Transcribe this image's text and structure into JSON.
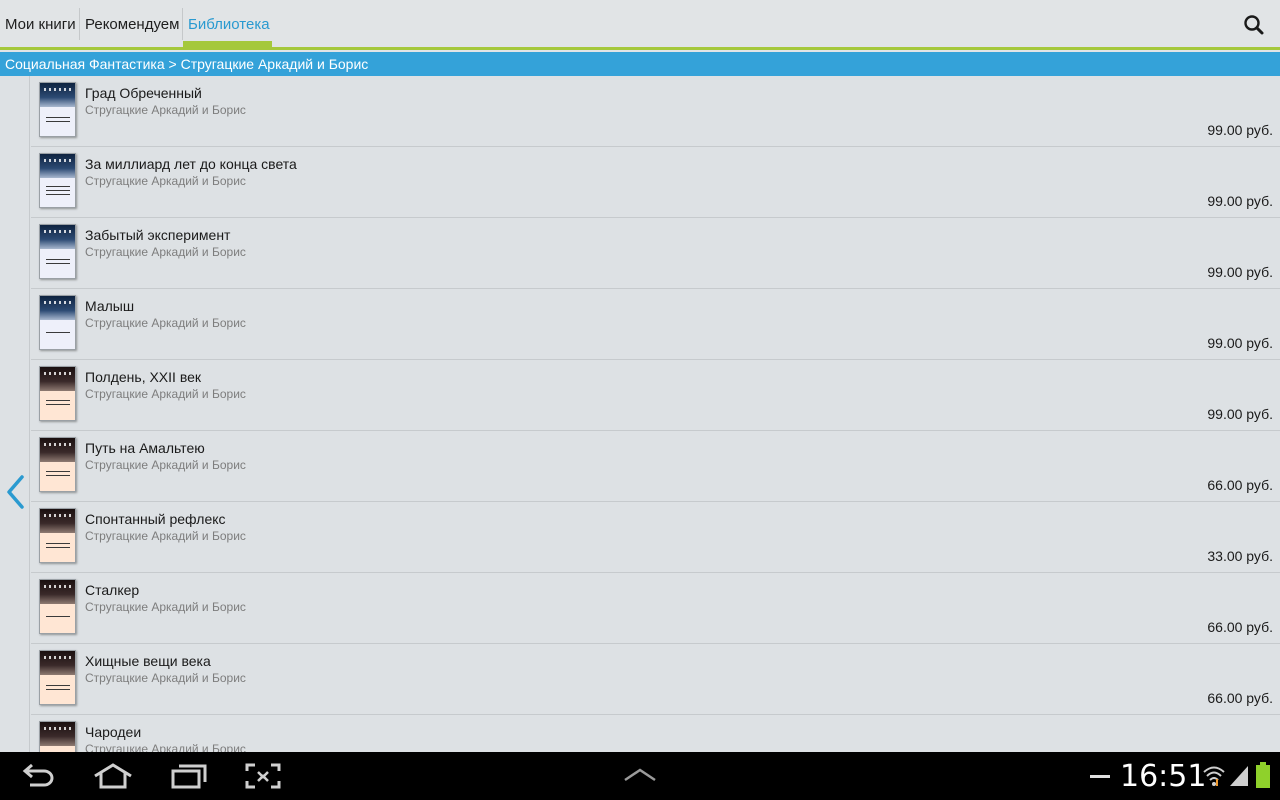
{
  "tabs": [
    {
      "label": "Мои книги"
    },
    {
      "label": "Рекомендуем"
    },
    {
      "label": "Библиотека"
    }
  ],
  "active_tab": "Библиотека",
  "breadcrumb": "Социальная Фантастика > Стругацкие Аркадий и Борис",
  "books": [
    {
      "title": "Град Обреченный",
      "author": "Стругацкие Аркадий и Борис",
      "price": "99.00 руб.",
      "cover": "blue"
    },
    {
      "title": "За миллиард лет до конца света",
      "author": "Стругацкие Аркадий и Борис",
      "price": "99.00 руб.",
      "cover": "blue"
    },
    {
      "title": "Забытый эксперимент",
      "author": "Стругацкие Аркадий и Борис",
      "price": "99.00 руб.",
      "cover": "blue"
    },
    {
      "title": "Малыш",
      "author": "Стругацкие Аркадий и Борис",
      "price": "99.00 руб.",
      "cover": "blue"
    },
    {
      "title": "Полдень, XXII век",
      "author": "Стругацкие Аркадий и Борис",
      "price": "99.00 руб.",
      "cover": "peach"
    },
    {
      "title": "Путь на Амальтею",
      "author": "Стругацкие Аркадий и Борис",
      "price": "66.00 руб.",
      "cover": "peach"
    },
    {
      "title": "Спонтанный рефлекс",
      "author": "Стругацкие Аркадий и Борис",
      "price": "33.00 руб.",
      "cover": "peach"
    },
    {
      "title": "Сталкер",
      "author": "Стругацкие Аркадий и Борис",
      "price": "66.00 руб.",
      "cover": "peach"
    },
    {
      "title": "Хищные вещи века",
      "author": "Стругацкие Аркадий и Борис",
      "price": "66.00 руб.",
      "cover": "peach"
    },
    {
      "title": "Чародеи",
      "author": "Стругацкие Аркадий и Борис",
      "price": "",
      "cover": "peach"
    }
  ],
  "status_bar": {
    "time": "16:51"
  },
  "colors": {
    "accent": "#34a2d9",
    "tab_indicator": "#a5c83c",
    "background": "#dde1e4"
  },
  "icons": {
    "search": "search-icon",
    "back_chevron": "chevron-left-icon",
    "nav_back": "back-icon",
    "nav_home": "home-icon",
    "nav_recent": "recent-apps-icon",
    "nav_screenshot": "screenshot-icon",
    "nav_up": "chevron-up-icon",
    "battery": "battery-icon",
    "wifi": "wifi-icon",
    "signal": "signal-icon"
  }
}
